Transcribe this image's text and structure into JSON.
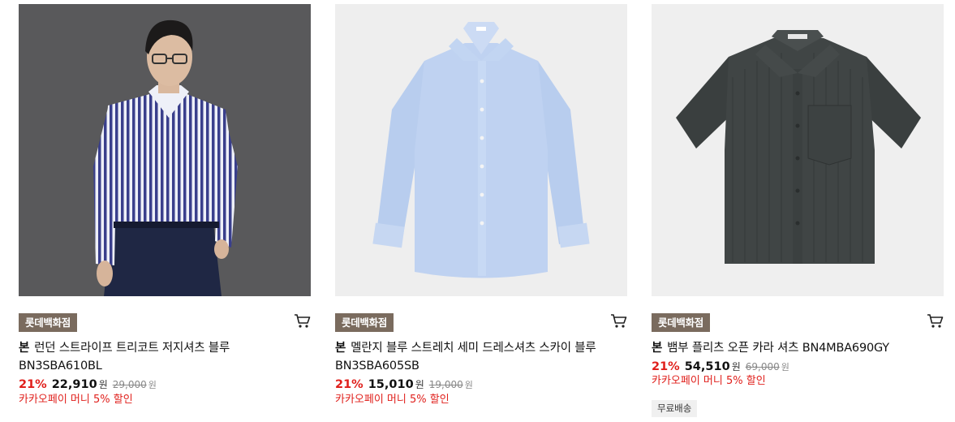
{
  "products": [
    {
      "badge": "롯데백화점",
      "brand": "본",
      "name": "런던 스트라이프 트리코트 저지셔츠 블루 BN3SBA610BL",
      "discount_rate": "21%",
      "price": "22,910",
      "price_unit": "원",
      "original_price": "29,000",
      "original_unit": "원",
      "promo": "카카오페이 머니 5% 할인",
      "shipping": ""
    },
    {
      "badge": "롯데백화점",
      "brand": "본",
      "name": "멜란지 블루 스트레치 세미 드레스셔츠 스카이 블루 BN3SBA605SB",
      "discount_rate": "21%",
      "price": "15,010",
      "price_unit": "원",
      "original_price": "19,000",
      "original_unit": "원",
      "promo": "카카오페이 머니 5% 할인",
      "shipping": ""
    },
    {
      "badge": "롯데백화점",
      "brand": "본",
      "name": "뱀부 플리츠 오픈 카라 셔츠 BN4MBA690GY",
      "discount_rate": "21%",
      "price": "54,510",
      "price_unit": "원",
      "original_price": "69,000",
      "original_unit": "원",
      "promo": "카카오페이 머니 5% 할인",
      "shipping": "무료배송"
    }
  ],
  "icons": {
    "cart": "cart-icon"
  },
  "colors": {
    "badge_bg": "#7a6b5e",
    "discount": "#e0201c",
    "promo": "#e0201c"
  }
}
